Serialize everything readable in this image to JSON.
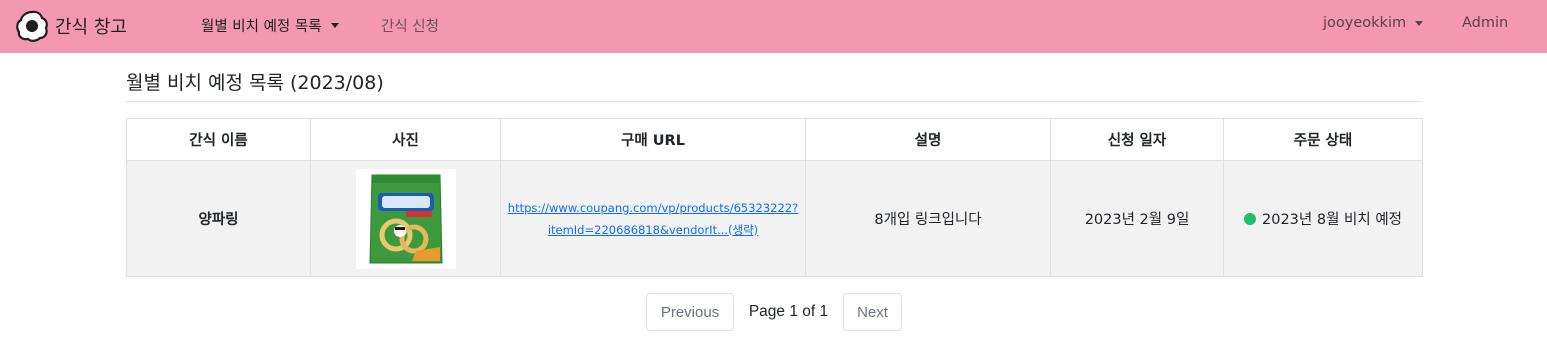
{
  "navbar": {
    "brand": "간식 창고",
    "monthly_menu": "월별 비치 예정 목록",
    "request_link": "간식 신청",
    "user_menu": "jooyeokkim",
    "admin_link": "Admin",
    "background_color": "#f498b1"
  },
  "page": {
    "title": "월별 비치 예정 목록 (2023/08)"
  },
  "table": {
    "headers": [
      "간식 이름",
      "사진",
      "구매 URL",
      "설명",
      "신청 일자",
      "주문 상태"
    ],
    "rows": [
      {
        "name": "양파링",
        "photo": "snack-package-image",
        "url_line1": "https://www.coupang.com/vp/products/65323222?",
        "url_line2": "itemId=220686818&vendorIt...(생략)",
        "description": "8개입 링크입니다",
        "date": "2023년 2월 9일",
        "status": "2023년 8월 비치 예정",
        "status_color": "#20c06d"
      }
    ]
  },
  "pagination": {
    "previous": "Previous",
    "info": "Page 1 of 1",
    "next": "Next"
  }
}
